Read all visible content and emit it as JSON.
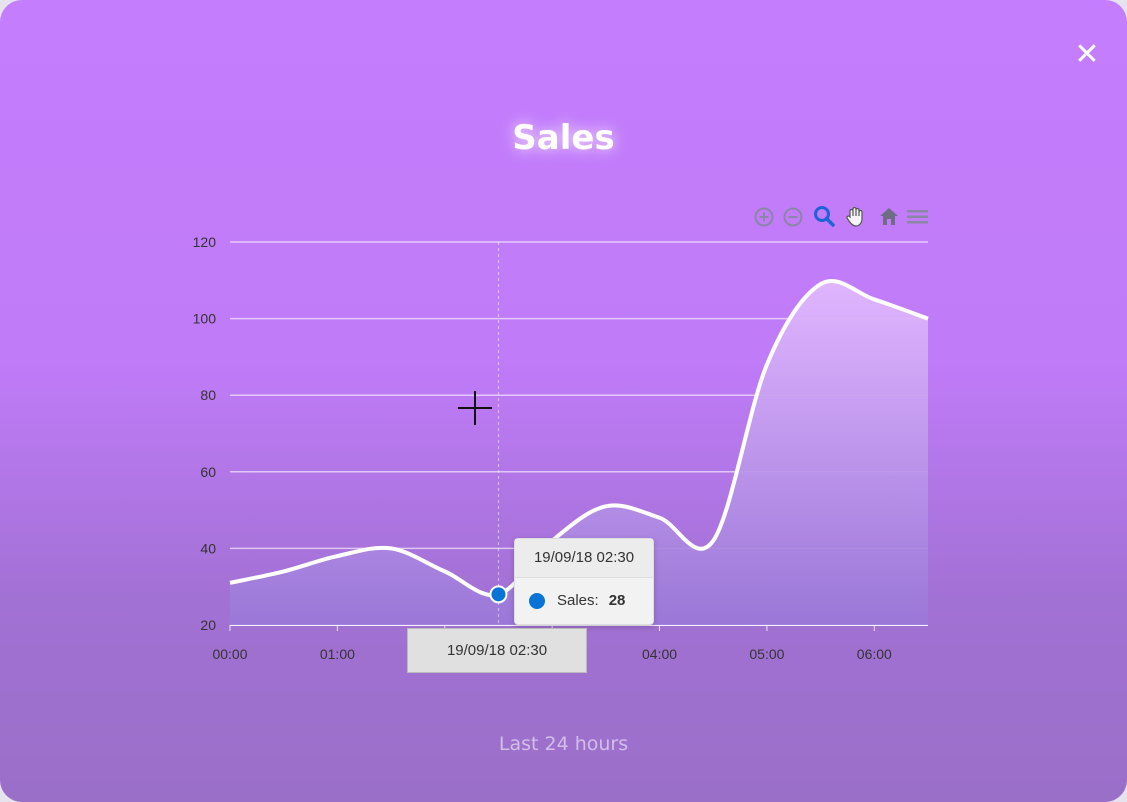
{
  "title": "Sales",
  "subtitle": "Last 24 hours",
  "close_label": "✕",
  "toolbar": {
    "icons": [
      "zoom-in-icon",
      "zoom-out-icon",
      "selection-zoom-icon",
      "pan-icon",
      "reset-home-icon",
      "menu-icon"
    ]
  },
  "tooltip": {
    "date": "19/09/18 02:30",
    "series": "Sales:",
    "value": "28"
  },
  "xaxis_tooltip": "19/09/18 02:30",
  "colors": {
    "line": "#ffffff",
    "marker": "#0a74d6",
    "active_tool": "#1e63d8"
  },
  "chart_data": {
    "type": "area",
    "title": "Sales",
    "subtitle": "Last 24 hours",
    "x": [
      "00:00",
      "00:30",
      "01:00",
      "01:30",
      "02:00",
      "02:30",
      "03:00",
      "03:30",
      "04:00",
      "04:30",
      "05:00",
      "05:30",
      "06:00",
      "06:30"
    ],
    "xtick_labels": [
      "00:00",
      "01:00",
      "02:00",
      "03:00",
      "04:00",
      "05:00",
      "06:00"
    ],
    "series": [
      {
        "name": "Sales",
        "values": [
          31,
          34,
          38,
          40,
          34,
          28,
          42,
          51,
          48,
          42,
          88,
          109,
          105,
          100
        ]
      }
    ],
    "ylim": [
      20,
      120
    ],
    "yticks": [
      20,
      40,
      60,
      80,
      100,
      120
    ],
    "grid": true
  }
}
